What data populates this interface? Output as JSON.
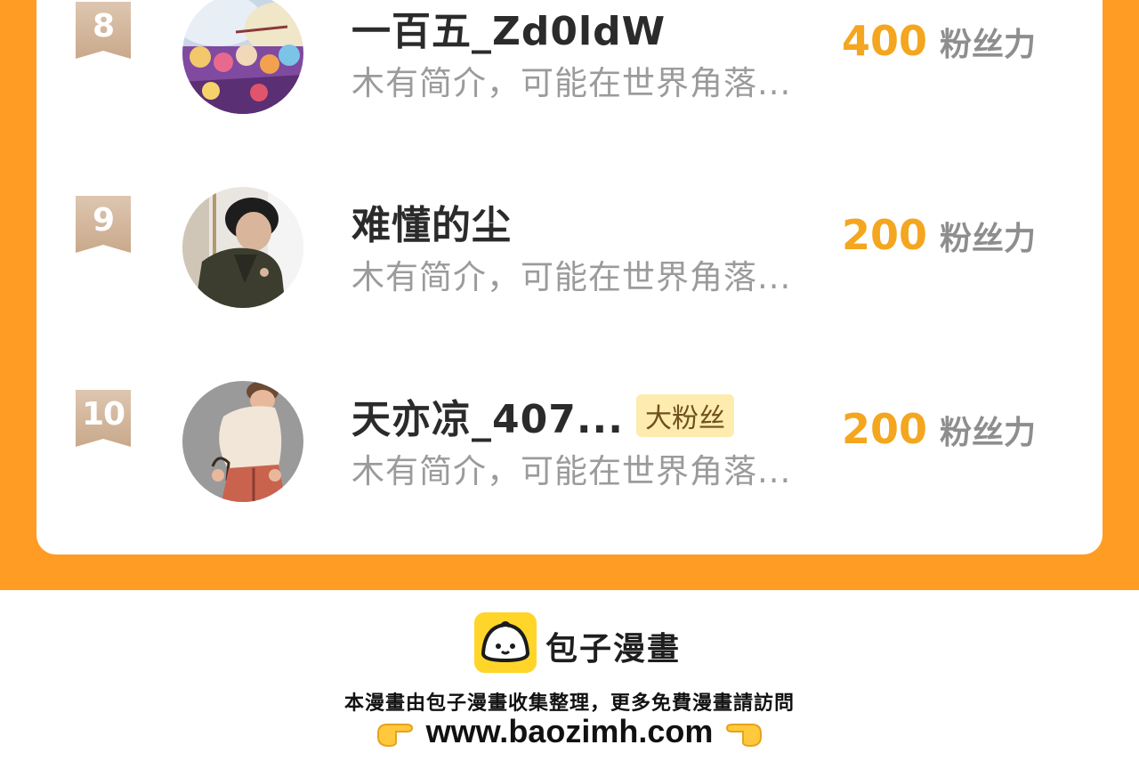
{
  "leaderboard": {
    "entries": [
      {
        "rank": "8",
        "name": "一百五_Zd0ldW",
        "badge": "",
        "bio": "木有简介，可能在世界角落...",
        "score": "400",
        "score_unit": "粉丝力",
        "avatar_icon": "avatar-anime-crowd"
      },
      {
        "rank": "9",
        "name": "难懂的尘",
        "badge": "",
        "bio": "木有简介，可能在世界角落...",
        "score": "200",
        "score_unit": "粉丝力",
        "avatar_icon": "avatar-man-in-coat"
      },
      {
        "rank": "10",
        "name": "天亦凉_407...",
        "badge": "大粉丝",
        "bio": "木有简介，可能在世界角落...",
        "score": "200",
        "score_unit": "粉丝力",
        "avatar_icon": "avatar-cartoon-person"
      }
    ]
  },
  "footer": {
    "brand": "包子漫畫",
    "notice": "本漫畫由包子漫畫收集整理，更多免費漫畫請訪問",
    "url": "www.baozimh.com",
    "logo_icon": "baozi-logo-icon",
    "pointer_icons": [
      "pointing-right-icon",
      "pointing-left-icon"
    ]
  },
  "colors": {
    "accent": "#ff9c24",
    "score": "#f4a61f",
    "badge_bg": "#fdecae",
    "rank_ribbon": "#d4b79b"
  }
}
